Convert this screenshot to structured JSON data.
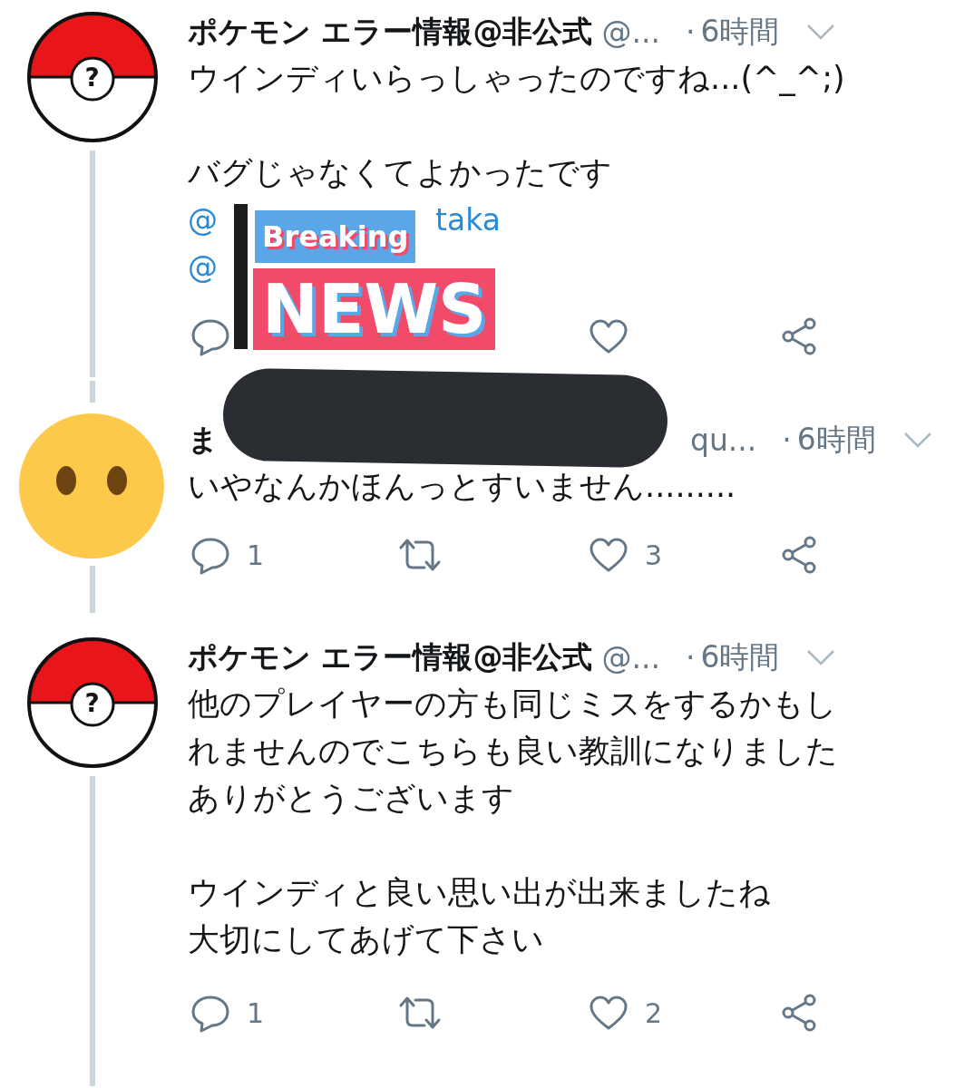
{
  "tweets": [
    {
      "avatar": {
        "kind": "pokeball",
        "mark": "?"
      },
      "thread_below": true,
      "name": "ポケモン エラー情報@非公式",
      "handle": "@...",
      "separator": "·",
      "time": "6時間",
      "body": [
        [
          "ウインディいらっしゃったのですね...(^_^;)"
        ],
        [
          "バグじゃなくてよかったです"
        ]
      ],
      "mentions": [
        [
          "@",
          "taka"
        ],
        [
          "@"
        ]
      ],
      "actions": [
        {
          "kind": "reply"
        },
        {
          "kind": "like"
        },
        {
          "kind": "share"
        }
      ],
      "sticker": {
        "top": "Breaking",
        "bottom": "NEWS"
      }
    },
    {
      "avatar": {
        "kind": "emoji"
      },
      "thread_above": true,
      "thread_below": true,
      "name": "ま",
      "handle": "qu...",
      "separator": "·",
      "time": "6時間",
      "name_redacted": true,
      "body": [
        [
          "いやなんかほんっとすいません........."
        ]
      ],
      "actions": [
        {
          "kind": "reply",
          "count": "1"
        },
        {
          "kind": "retweet"
        },
        {
          "kind": "like",
          "count": "3"
        },
        {
          "kind": "share"
        }
      ]
    },
    {
      "avatar": {
        "kind": "pokeball",
        "mark": "?"
      },
      "thread_below": true,
      "name": "ポケモン エラー情報@非公式",
      "handle": "@...",
      "separator": "·",
      "time": "6時間",
      "body": [
        [
          "他のプレイヤーの方も同じミスをするかもし",
          "れませんのでこちらも良い教訓になりました",
          "ありがとうございます"
        ],
        [
          "ウインディと良い思い出が出来ましたね",
          "大切にしてあげて下さい"
        ]
      ],
      "actions": [
        {
          "kind": "reply",
          "count": "1"
        },
        {
          "kind": "retweet"
        },
        {
          "kind": "like",
          "count": "2"
        },
        {
          "kind": "share"
        }
      ]
    }
  ]
}
